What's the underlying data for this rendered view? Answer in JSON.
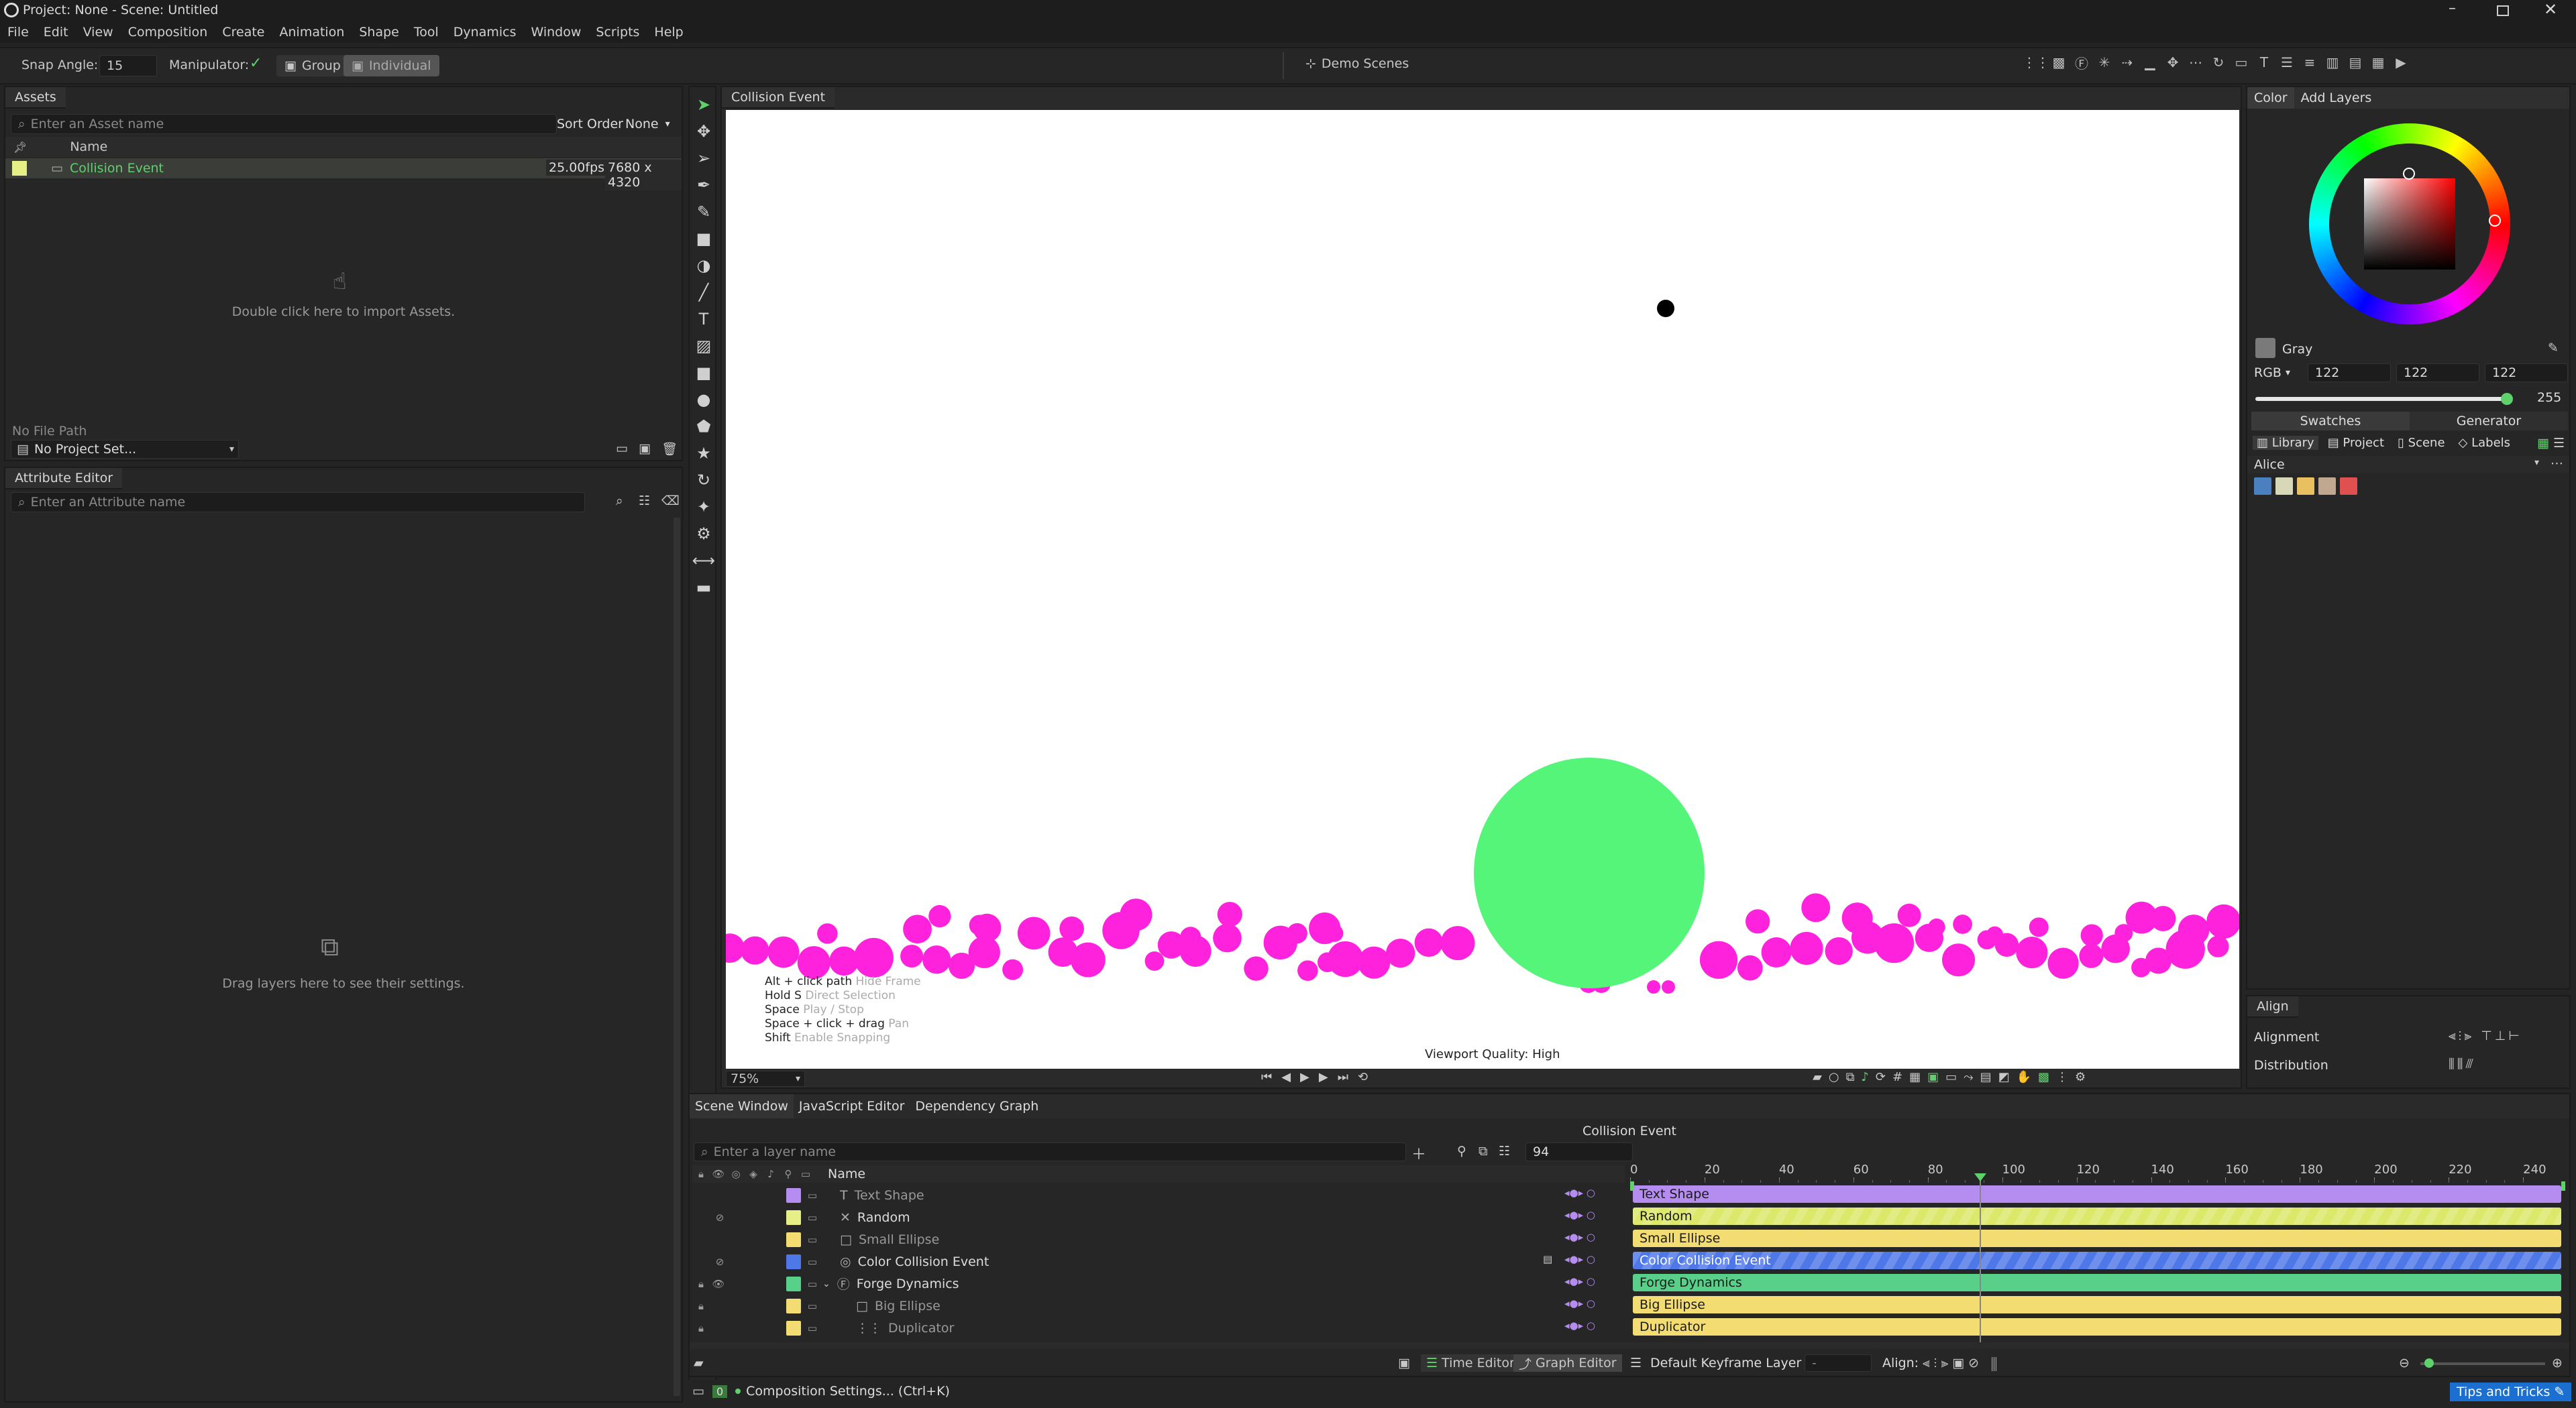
{
  "window": {
    "title": "Project: None - Scene: Untitled"
  },
  "menu": [
    "File",
    "Edit",
    "View",
    "Composition",
    "Create",
    "Animation",
    "Shape",
    "Tool",
    "Dynamics",
    "Window",
    "Scripts",
    "Help"
  ],
  "toolbar": {
    "snap_label": "Snap Angle:",
    "snap_value": "15",
    "manipulator_label": "Manipulator:",
    "group_label": "Group",
    "individual_label": "Individual",
    "demo_scenes": "Demo Scenes"
  },
  "assets": {
    "tab": "Assets",
    "search_placeholder": "Enter an Asset name",
    "sort_label": "Sort Order",
    "sort_value": "None",
    "col_name": "Name",
    "item": {
      "name": "Collision Event",
      "fps": "25.00fps",
      "size": "7680 x 4320"
    },
    "import_hint": "Double click here to import Assets.",
    "file_path": "No File Path",
    "project_set": "No Project Set..."
  },
  "attribute_editor": {
    "tab": "Attribute Editor",
    "search_placeholder": "Enter an Attribute name",
    "drag_hint": "Drag layers here to see their settings."
  },
  "viewport": {
    "tab": "Collision Event",
    "quality": "Viewport Quality: High",
    "zoom": "75%",
    "hints": [
      {
        "key": "Alt + click path",
        "desc": "Hide Frame"
      },
      {
        "key": "Hold S",
        "desc": "Direct Selection"
      },
      {
        "key": "Space",
        "desc": "Play / Stop"
      },
      {
        "key": "Space + click + drag",
        "desc": "Pan"
      },
      {
        "key": "Shift",
        "desc": "Enable Snapping"
      }
    ],
    "colors": {
      "ball": "#ff22dd",
      "big_circle": "#55f57a",
      "dot": "#000000"
    }
  },
  "color_panel": {
    "tabs": [
      "Color",
      "Add Layers"
    ],
    "color_name": "Gray",
    "mode": "RGB",
    "r": "122",
    "g": "122",
    "b": "122",
    "alpha": "255",
    "subtabs": [
      "Swatches",
      "Generator"
    ],
    "lib_tabs": [
      "Library",
      "Project",
      "Scene",
      "Labels"
    ],
    "palette_name": "Alice",
    "swatches": [
      "#4a7fc0",
      "#d8d8b8",
      "#e8c060",
      "#c0a890",
      "#e05050"
    ]
  },
  "align_panel": {
    "tab": "Align",
    "alignment": "Alignment",
    "distribution": "Distribution"
  },
  "scene": {
    "tabs": [
      "Scene Window",
      "JavaScript Editor",
      "Dependency Graph"
    ],
    "title": "Collision Event",
    "search_placeholder": "Enter a layer name",
    "frame": "94",
    "col_name": "Name",
    "ticks": [
      "0",
      "20",
      "40",
      "60",
      "80",
      "100",
      "120",
      "140",
      "160",
      "180",
      "200",
      "220",
      "240"
    ],
    "layers": [
      {
        "name": "Text Shape",
        "color": "#b58cf0",
        "bar": "#b58cf0",
        "hatch": false,
        "dim": true
      },
      {
        "name": "Random",
        "color": "#e6ee86",
        "bar": "#dbe86a",
        "hatch": true,
        "dim": false
      },
      {
        "name": "Small Ellipse",
        "color": "#f3dc72",
        "bar": "#f3dc72",
        "hatch": false,
        "dim": true
      },
      {
        "name": "Color Collision Event",
        "color": "#4e78e8",
        "bar": "#4e78e8",
        "hatch": true,
        "dim": false
      },
      {
        "name": "Forge Dynamics",
        "color": "#58d08a",
        "bar": "#58d08a",
        "hatch": false,
        "dim": false
      },
      {
        "name": "Big Ellipse",
        "color": "#f3dc72",
        "bar": "#f3dc72",
        "hatch": false,
        "dim": true
      },
      {
        "name": "Duplicator",
        "color": "#f3dc72",
        "bar": "#f3dc72",
        "hatch": false,
        "dim": true
      }
    ],
    "time_editor": "Time Editor",
    "graph_editor": "Graph Editor",
    "keyframe_layer": "Default Keyframe Layer",
    "keyframe_value": "-",
    "align_label": "Align:"
  },
  "status": {
    "num": "0",
    "text": "Composition Settings... (Ctrl+K)",
    "tips": "Tips and Tricks"
  }
}
